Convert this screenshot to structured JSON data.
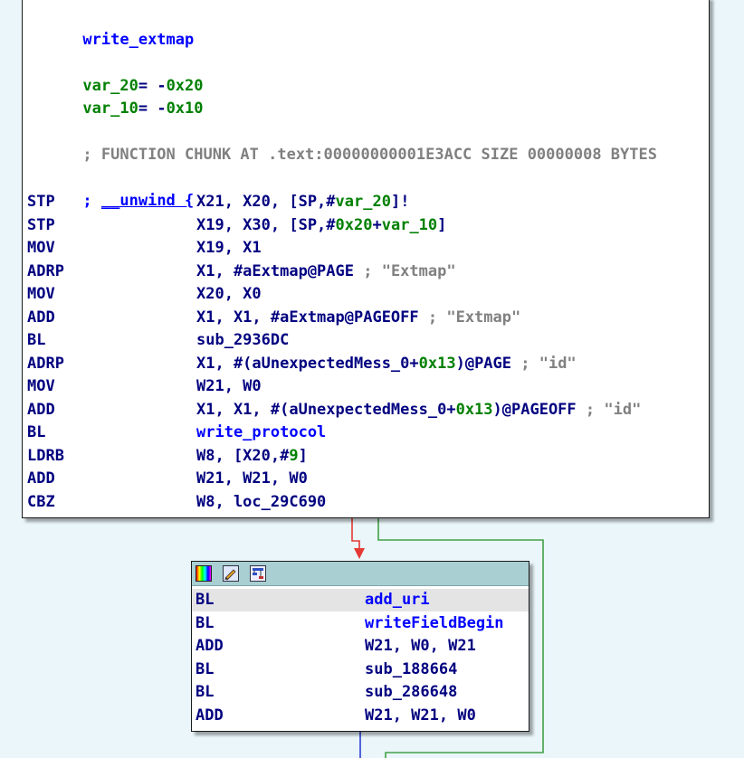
{
  "main_node": {
    "func_name": "write_extmap",
    "vars": [
      {
        "name": "var_20",
        "eq": "= -",
        "val": "0x20"
      },
      {
        "name": "var_10",
        "eq": "= -",
        "val": "0x10"
      }
    ],
    "chunk_comment": "; FUNCTION CHUNK AT .text:00000000001E3ACC SIZE 00000008 BYTES",
    "unwind_prefix": "; ",
    "unwind_label": "__unwind {",
    "instructions": [
      {
        "mnem": "STP",
        "ops": [
          {
            "t": "X21, X20, [SP,#",
            "c": "reg"
          },
          {
            "t": "var_20",
            "c": "var"
          },
          {
            "t": "]!",
            "c": "reg"
          }
        ]
      },
      {
        "mnem": "STP",
        "ops": [
          {
            "t": "X19, X30, [SP,#",
            "c": "reg"
          },
          {
            "t": "0x20",
            "c": "num"
          },
          {
            "t": "+",
            "c": "reg"
          },
          {
            "t": "var_10",
            "c": "var"
          },
          {
            "t": "]",
            "c": "reg"
          }
        ]
      },
      {
        "mnem": "MOV",
        "ops": [
          {
            "t": "X19, X1",
            "c": "reg"
          }
        ]
      },
      {
        "mnem": "ADRP",
        "ops": [
          {
            "t": "X1, #aExtmap@PAGE",
            "c": "reg"
          },
          {
            "t": " ; \"Extmap\"",
            "c": "cmt"
          }
        ]
      },
      {
        "mnem": "MOV",
        "ops": [
          {
            "t": "X20, X0",
            "c": "reg"
          }
        ]
      },
      {
        "mnem": "ADD",
        "ops": [
          {
            "t": "X1, X1, #aExtmap@PAGEOFF",
            "c": "reg"
          },
          {
            "t": " ; \"Extmap\"",
            "c": "cmt"
          }
        ]
      },
      {
        "mnem": "BL",
        "ops": [
          {
            "t": "sub_2936DC",
            "c": "reg"
          }
        ]
      },
      {
        "mnem": "ADRP",
        "ops": [
          {
            "t": "X1, #(aUnexpectedMess_0+",
            "c": "reg"
          },
          {
            "t": "0x13",
            "c": "num"
          },
          {
            "t": ")@PAGE",
            "c": "reg"
          },
          {
            "t": " ; \"id\"",
            "c": "cmt"
          }
        ]
      },
      {
        "mnem": "MOV",
        "ops": [
          {
            "t": "W21, W0",
            "c": "reg"
          }
        ]
      },
      {
        "mnem": "ADD",
        "ops": [
          {
            "t": "X1, X1, #(aUnexpectedMess_0+",
            "c": "reg"
          },
          {
            "t": "0x13",
            "c": "num"
          },
          {
            "t": ")@PAGEOFF",
            "c": "reg"
          },
          {
            "t": " ; \"id\"",
            "c": "cmt"
          }
        ]
      },
      {
        "mnem": "BL",
        "ops": [
          {
            "t": "write_protocol",
            "c": "name"
          }
        ]
      },
      {
        "mnem": "LDRB",
        "ops": [
          {
            "t": "W8, [X20,#",
            "c": "reg"
          },
          {
            "t": "9",
            "c": "num"
          },
          {
            "t": "]",
            "c": "reg"
          }
        ]
      },
      {
        "mnem": "ADD",
        "ops": [
          {
            "t": "W21, W21, W0",
            "c": "reg"
          }
        ]
      },
      {
        "mnem": "CBZ",
        "ops": [
          {
            "t": "W8, loc_29C690",
            "c": "reg"
          }
        ]
      }
    ]
  },
  "small_node": {
    "header_icons": [
      "palette-icon",
      "edit-icon",
      "graph-icon"
    ],
    "instructions": [
      {
        "mnem": "BL",
        "ops": [
          {
            "t": "add_uri",
            "c": "name"
          }
        ]
      },
      {
        "mnem": "BL",
        "ops": [
          {
            "t": "writeFieldBegin",
            "c": "name"
          }
        ]
      },
      {
        "mnem": "ADD",
        "ops": [
          {
            "t": "W21, W0, W21",
            "c": "reg"
          }
        ]
      },
      {
        "mnem": "BL",
        "ops": [
          {
            "t": "sub_188664",
            "c": "reg"
          }
        ]
      },
      {
        "mnem": "BL",
        "ops": [
          {
            "t": "sub_286648",
            "c": "reg"
          }
        ]
      },
      {
        "mnem": "ADD",
        "ops": [
          {
            "t": "W21, W21, W0",
            "c": "reg"
          }
        ]
      }
    ]
  },
  "colors": {
    "background": "#eaf6fa",
    "edge_true": "#e53935",
    "edge_false": "#43a047",
    "edge_down": "#2a3fcf",
    "header": "#a9cfd3"
  }
}
